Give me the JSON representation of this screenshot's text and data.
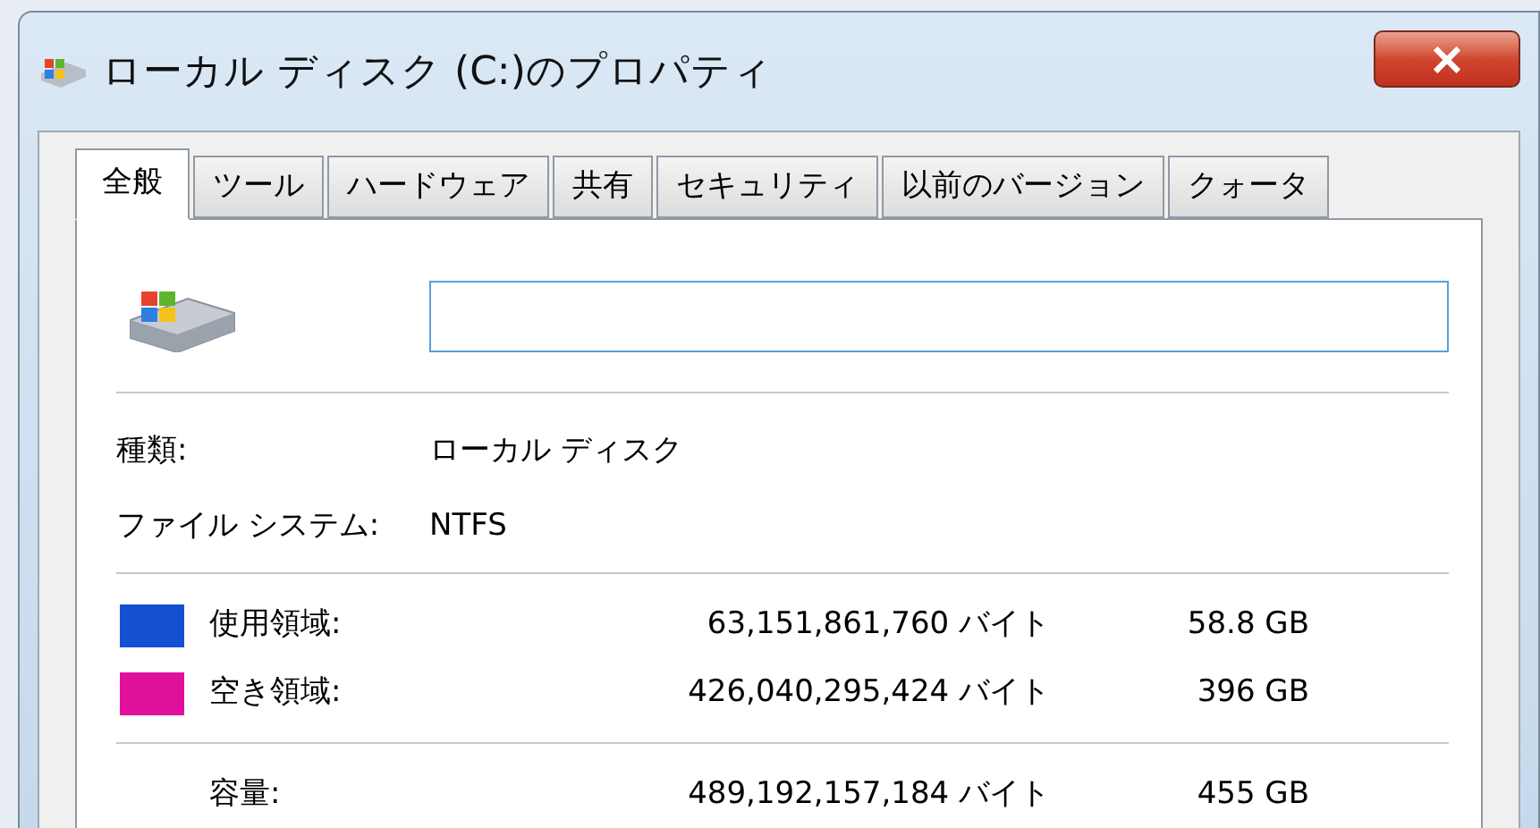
{
  "window": {
    "title": "ローカル ディスク (C:)のプロパティ"
  },
  "tabs": [
    {
      "label": "全般",
      "selected": true
    },
    {
      "label": "ツール",
      "selected": false
    },
    {
      "label": "ハードウェア",
      "selected": false
    },
    {
      "label": "共有",
      "selected": false
    },
    {
      "label": "セキュリティ",
      "selected": false
    },
    {
      "label": "以前のバージョン",
      "selected": false
    },
    {
      "label": "クォータ",
      "selected": false
    }
  ],
  "info": [
    {
      "label": "種類:",
      "value": "ローカル ディスク"
    },
    {
      "label": "ファイル システム:",
      "value": "NTFS"
    }
  ],
  "usage": [
    {
      "label": "使用領域:",
      "bytes": "63,151,861,760 バイト",
      "size": "58.8 GB",
      "color": "#1450d2"
    },
    {
      "label": "空き領域:",
      "bytes": "426,040,295,424 バイト",
      "size": "396 GB",
      "color": "#e0109a"
    }
  ],
  "capacity": {
    "label": "容量:",
    "bytes": "489,192,157,184 バイト",
    "size": "455 GB"
  }
}
